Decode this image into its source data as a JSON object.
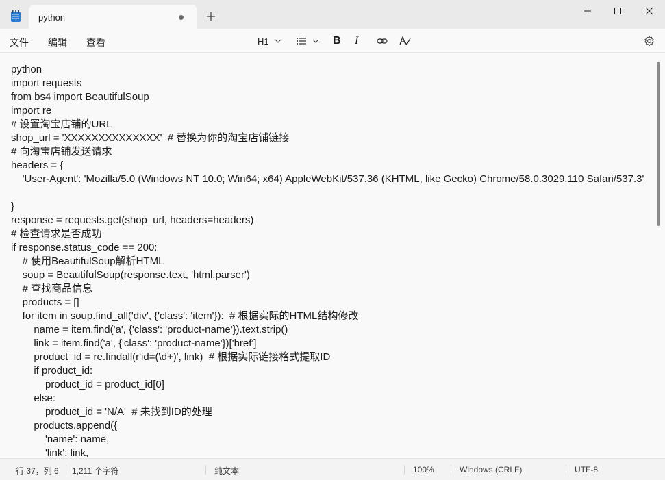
{
  "tab": {
    "title": "python"
  },
  "menu": {
    "file": "文件",
    "edit": "编辑",
    "view": "查看"
  },
  "toolbar": {
    "heading": "H1",
    "bold": "B",
    "italic": "I"
  },
  "editor": {
    "lines": [
      "python",
      "import requests",
      "from bs4 import BeautifulSoup",
      "import re",
      "# 设置淘宝店铺的URL",
      "shop_url = 'XXXXXXXXXXXXXX'  # 替换为你的淘宝店铺链接",
      "# 向淘宝店铺发送请求",
      "headers = {",
      "    'User-Agent': 'Mozilla/5.0 (Windows NT 10.0; Win64; x64) AppleWebKit/537.36 (KHTML, like Gecko) Chrome/58.0.3029.110 Safari/537.3'",
      "}",
      "response = requests.get(shop_url, headers=headers)",
      "# 检查请求是否成功",
      "if response.status_code == 200:",
      "    # 使用BeautifulSoup解析HTML",
      "    soup = BeautifulSoup(response.text, 'html.parser')",
      "    # 查找商品信息",
      "    products = []",
      "    for item in soup.find_all('div', {'class': 'item'}):  # 根据实际的HTML结构修改",
      "        name = item.find('a', {'class': 'product-name'}).text.strip()",
      "        link = item.find('a', {'class': 'product-name'})['href']",
      "        product_id = re.findall(r'id=(\\d+)', link)  # 根据实际链接格式提取ID",
      "        if product_id:",
      "            product_id = product_id[0]",
      "        else:",
      "            product_id = 'N/A'  # 未找到ID的处理",
      "        products.append({",
      "            'name': name,",
      "            'link': link,"
    ]
  },
  "status": {
    "position": "行 37，列 6",
    "char_count": "1,211 个字符",
    "format": "纯文本",
    "zoom": "100%",
    "line_ending": "Windows (CRLF)",
    "encoding": "UTF-8"
  },
  "icons": {
    "app": "notepad-icon",
    "close_tab": "unsaved-dot-icon",
    "new_tab": "plus-icon",
    "minimize": "minimize-icon",
    "maximize": "maximize-icon",
    "close": "close-icon",
    "list": "bullet-list-icon",
    "link": "link-icon",
    "spellcheck": "spellcheck-icon",
    "settings": "gear-icon"
  }
}
